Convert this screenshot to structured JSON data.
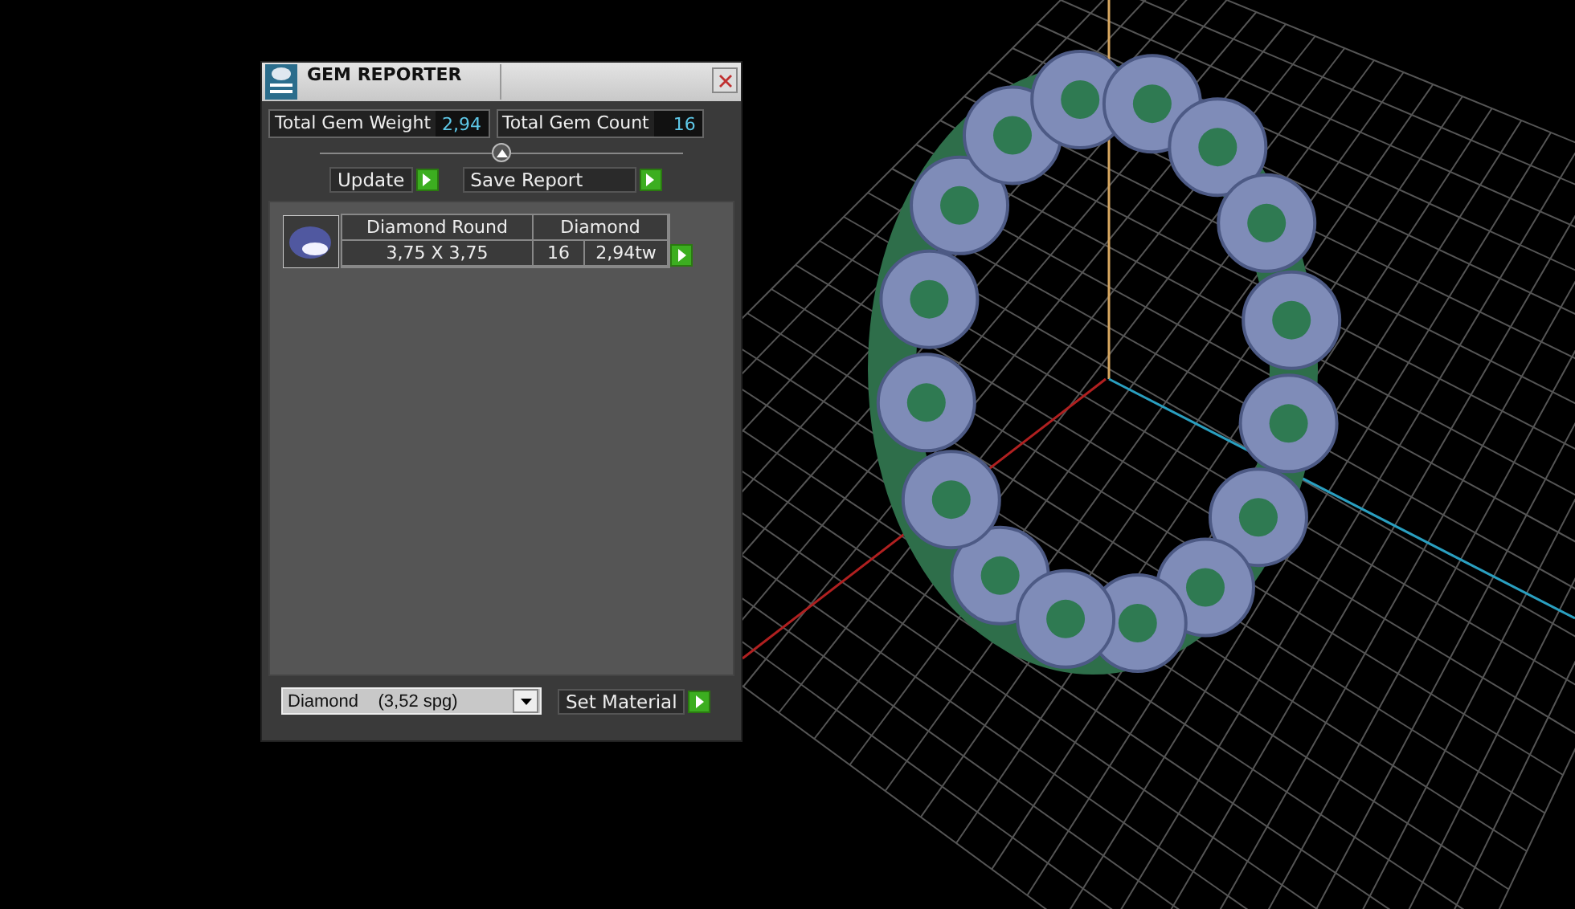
{
  "window": {
    "title": "GEM REPORTER"
  },
  "totals": [
    {
      "label": "Total Gem Weight",
      "value": "2,94"
    },
    {
      "label": "Total Gem Count",
      "value": "16"
    }
  ],
  "buttons": [
    {
      "label": "Update"
    },
    {
      "label": "Save Report"
    }
  ],
  "gems": [
    {
      "name": "Diamond Round",
      "material": "Diamond",
      "size": "3,75 X 3,75",
      "count": "16",
      "weight": "2,94tw"
    }
  ],
  "material": {
    "value": "Diamond    (3,52 spg)",
    "button": "Set Material"
  }
}
